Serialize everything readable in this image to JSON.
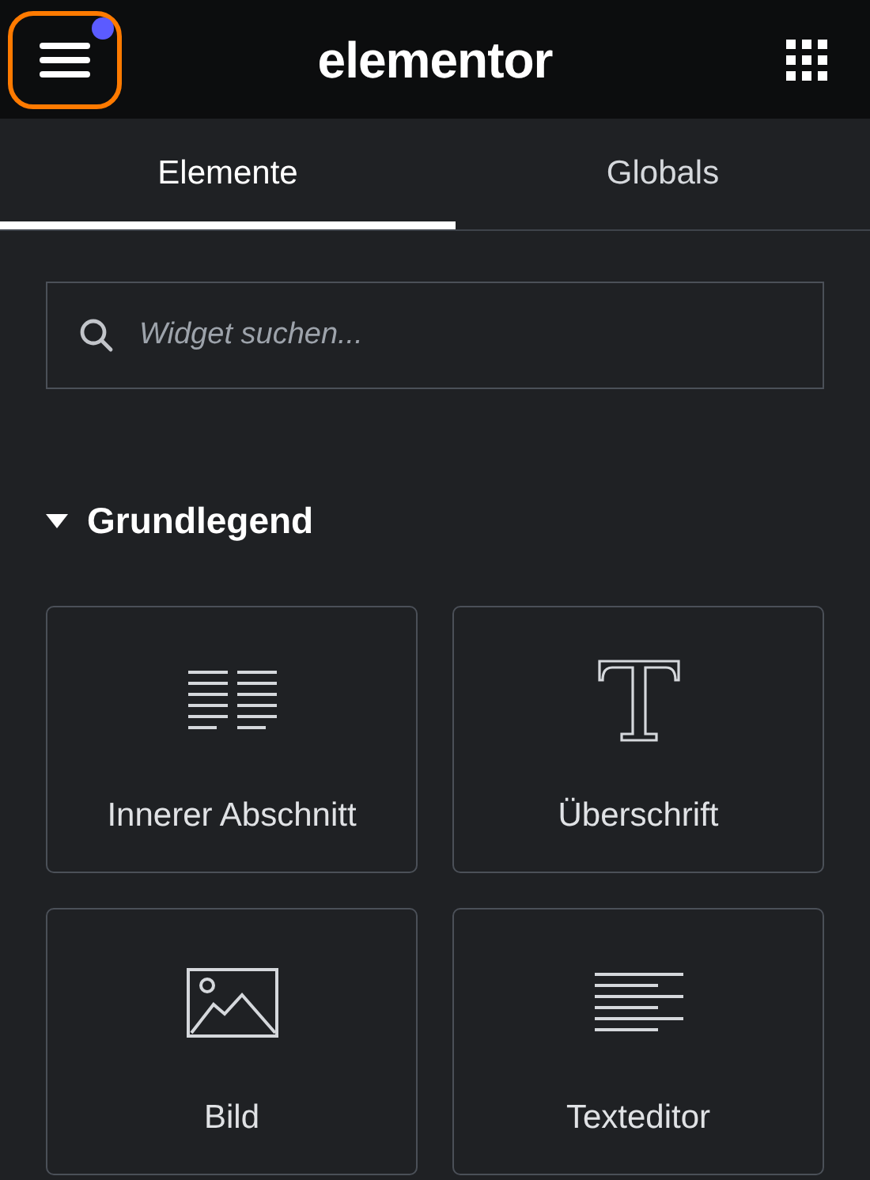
{
  "header": {
    "logo": "elementor",
    "menu_button": {
      "highlighted": true,
      "notification": true
    }
  },
  "tabs": [
    {
      "label": "Elemente",
      "selected": true
    },
    {
      "label": "Globals",
      "selected": false
    }
  ],
  "search": {
    "placeholder": "Widget suchen..."
  },
  "section": {
    "title": "Grundlegend",
    "expanded": true,
    "widgets": [
      {
        "kind": "inner-section",
        "label": "Innerer Abschnitt"
      },
      {
        "kind": "heading",
        "label": "Überschrift"
      },
      {
        "kind": "image",
        "label": "Bild"
      },
      {
        "kind": "text-editor",
        "label": "Texteditor"
      }
    ]
  }
}
